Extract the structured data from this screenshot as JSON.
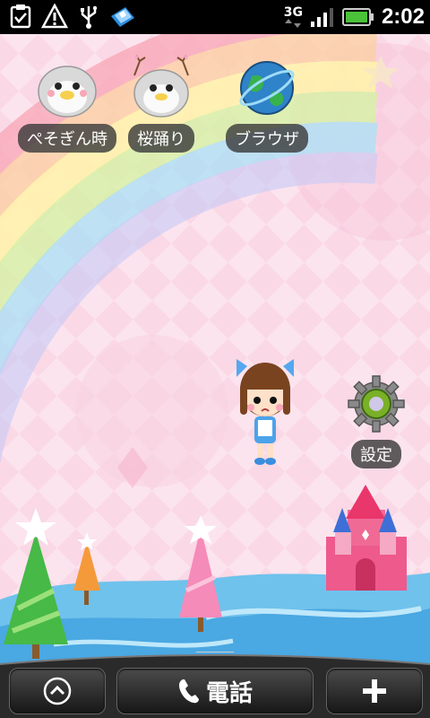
{
  "status_bar": {
    "network": "3G",
    "time": "2:02",
    "icons": [
      "clipboard-check-icon",
      "warning-icon",
      "usb-icon",
      "app-notification-icon",
      "signal-icon",
      "battery-icon"
    ]
  },
  "shortcuts": [
    {
      "label": "ぺそぎん時",
      "icon": "penguin-clock-icon"
    },
    {
      "label": "桜踊り",
      "icon": "penguin-sakura-icon"
    },
    {
      "label": "ブラウザ",
      "icon": "browser-globe-icon"
    },
    {
      "label": "設定",
      "icon": "settings-gear-icon"
    }
  ],
  "dock": {
    "phone_label": "電話",
    "left_button_icon": "chevron-up-icon",
    "right_button_icon": "plus-icon"
  },
  "colors": {
    "status_bar_bg": "#000000",
    "battery": "#4cc23a",
    "label_bg": "#3c3c3c",
    "wallpaper_pink": "#fbdde9"
  }
}
